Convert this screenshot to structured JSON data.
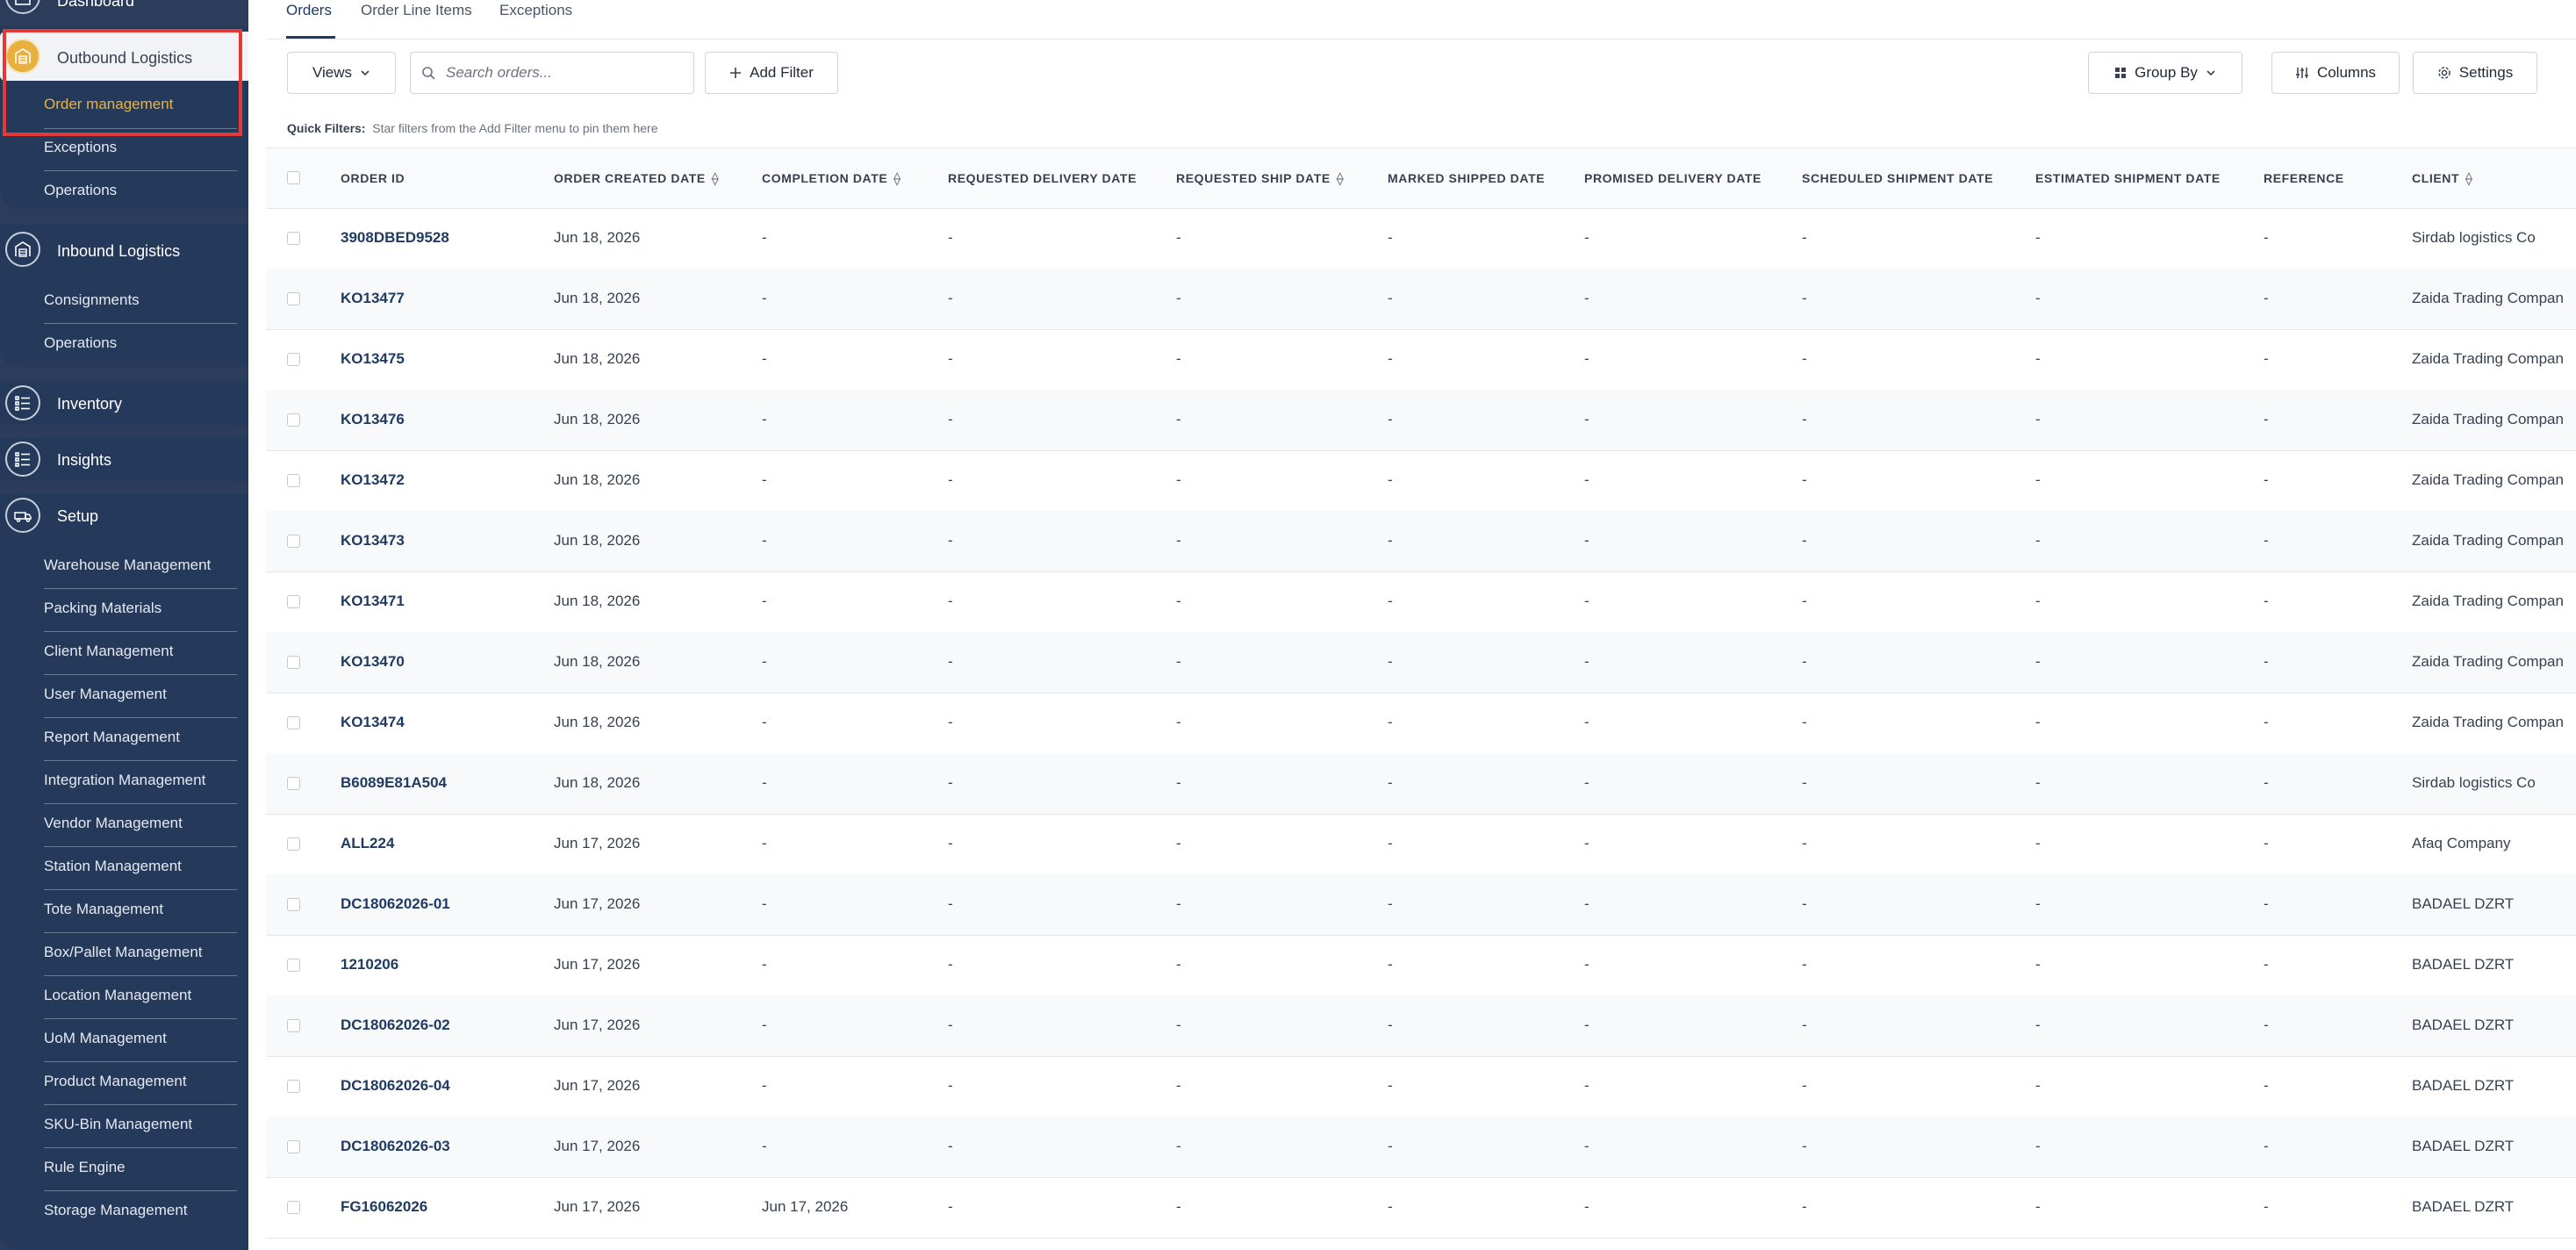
{
  "sidebar": {
    "dashboard_label": "Dashboard",
    "outbound_label": "Outbound Logistics",
    "outbound_items": [
      {
        "label": "Order management",
        "active": true
      },
      {
        "label": "Exceptions",
        "active": false
      },
      {
        "label": "Operations",
        "active": false
      }
    ],
    "inbound_label": "Inbound Logistics",
    "inbound_items": [
      {
        "label": "Consignments"
      },
      {
        "label": "Operations"
      }
    ],
    "inventory_label": "Inventory",
    "insights_label": "Insights",
    "setup_label": "Setup",
    "setup_items": [
      {
        "label": "Warehouse Management"
      },
      {
        "label": "Packing Materials"
      },
      {
        "label": "Client Management"
      },
      {
        "label": "User Management"
      },
      {
        "label": "Report Management"
      },
      {
        "label": "Integration Management"
      },
      {
        "label": "Vendor Management"
      },
      {
        "label": "Station Management"
      },
      {
        "label": "Tote Management"
      },
      {
        "label": "Box/Pallet Management"
      },
      {
        "label": "Location Management"
      },
      {
        "label": "UoM Management"
      },
      {
        "label": "Product Management"
      },
      {
        "label": "SKU-Bin Management"
      },
      {
        "label": "Rule Engine"
      },
      {
        "label": "Storage Management"
      }
    ],
    "colors": {
      "bg": "#2b3d5b",
      "active_accent": "#eab33e",
      "highlight_border": "#e53935"
    }
  },
  "tabs": [
    {
      "label": "Orders",
      "active": true
    },
    {
      "label": "Order Line Items",
      "active": false
    },
    {
      "label": "Exceptions",
      "active": false
    }
  ],
  "toolbar": {
    "views_label": "Views",
    "search_placeholder": "Search orders...",
    "add_filter_label": "Add Filter",
    "group_by_label": "Group By",
    "columns_label": "Columns",
    "settings_label": "Settings"
  },
  "quick_filters": {
    "label": "Quick Filters:",
    "hint": "Star filters from the Add Filter menu to pin them here"
  },
  "table": {
    "columns": [
      {
        "label": "ORDER ID",
        "sortable": false
      },
      {
        "label": "ORDER CREATED DATE",
        "sortable": true
      },
      {
        "label": "COMPLETION DATE",
        "sortable": true
      },
      {
        "label": "REQUESTED DELIVERY DATE",
        "sortable": false
      },
      {
        "label": "REQUESTED SHIP DATE",
        "sortable": true
      },
      {
        "label": "MARKED SHIPPED DATE",
        "sortable": false
      },
      {
        "label": "PROMISED DELIVERY DATE",
        "sortable": false
      },
      {
        "label": "SCHEDULED SHIPMENT DATE",
        "sortable": false
      },
      {
        "label": "ESTIMATED SHIPMENT DATE",
        "sortable": false
      },
      {
        "label": "REFERENCE",
        "sortable": false
      },
      {
        "label": "CLIENT",
        "sortable": true
      }
    ],
    "rows": [
      [
        "3908DBED9528",
        "Jun 18, 2026",
        "-",
        "-",
        "-",
        "-",
        "-",
        "-",
        "-",
        "-",
        "Sirdab logistics Co"
      ],
      [
        "KO13477",
        "Jun 18, 2026",
        "-",
        "-",
        "-",
        "-",
        "-",
        "-",
        "-",
        "-",
        "Zaida Trading Compan"
      ],
      [
        "KO13475",
        "Jun 18, 2026",
        "-",
        "-",
        "-",
        "-",
        "-",
        "-",
        "-",
        "-",
        "Zaida Trading Compan"
      ],
      [
        "KO13476",
        "Jun 18, 2026",
        "-",
        "-",
        "-",
        "-",
        "-",
        "-",
        "-",
        "-",
        "Zaida Trading Compan"
      ],
      [
        "KO13472",
        "Jun 18, 2026",
        "-",
        "-",
        "-",
        "-",
        "-",
        "-",
        "-",
        "-",
        "Zaida Trading Compan"
      ],
      [
        "KO13473",
        "Jun 18, 2026",
        "-",
        "-",
        "-",
        "-",
        "-",
        "-",
        "-",
        "-",
        "Zaida Trading Compan"
      ],
      [
        "KO13471",
        "Jun 18, 2026",
        "-",
        "-",
        "-",
        "-",
        "-",
        "-",
        "-",
        "-",
        "Zaida Trading Compan"
      ],
      [
        "KO13470",
        "Jun 18, 2026",
        "-",
        "-",
        "-",
        "-",
        "-",
        "-",
        "-",
        "-",
        "Zaida Trading Compan"
      ],
      [
        "KO13474",
        "Jun 18, 2026",
        "-",
        "-",
        "-",
        "-",
        "-",
        "-",
        "-",
        "-",
        "Zaida Trading Compan"
      ],
      [
        "B6089E81A504",
        "Jun 18, 2026",
        "-",
        "-",
        "-",
        "-",
        "-",
        "-",
        "-",
        "-",
        "Sirdab logistics Co"
      ],
      [
        "ALL224",
        "Jun 17, 2026",
        "-",
        "-",
        "-",
        "-",
        "-",
        "-",
        "-",
        "-",
        "Afaq Company"
      ],
      [
        "DC18062026-01",
        "Jun 17, 2026",
        "-",
        "-",
        "-",
        "-",
        "-",
        "-",
        "-",
        "-",
        "BADAEL DZRT"
      ],
      [
        "1210206",
        "Jun 17, 2026",
        "-",
        "-",
        "-",
        "-",
        "-",
        "-",
        "-",
        "-",
        "BADAEL DZRT"
      ],
      [
        "DC18062026-02",
        "Jun 17, 2026",
        "-",
        "-",
        "-",
        "-",
        "-",
        "-",
        "-",
        "-",
        "BADAEL DZRT"
      ],
      [
        "DC18062026-04",
        "Jun 17, 2026",
        "-",
        "-",
        "-",
        "-",
        "-",
        "-",
        "-",
        "-",
        "BADAEL DZRT"
      ],
      [
        "DC18062026-03",
        "Jun 17, 2026",
        "-",
        "-",
        "-",
        "-",
        "-",
        "-",
        "-",
        "-",
        "BADAEL DZRT"
      ],
      [
        "FG16062026",
        "Jun 17, 2026",
        "Jun 17, 2026",
        "-",
        "-",
        "-",
        "-",
        "-",
        "-",
        "-",
        "BADAEL DZRT"
      ]
    ]
  }
}
